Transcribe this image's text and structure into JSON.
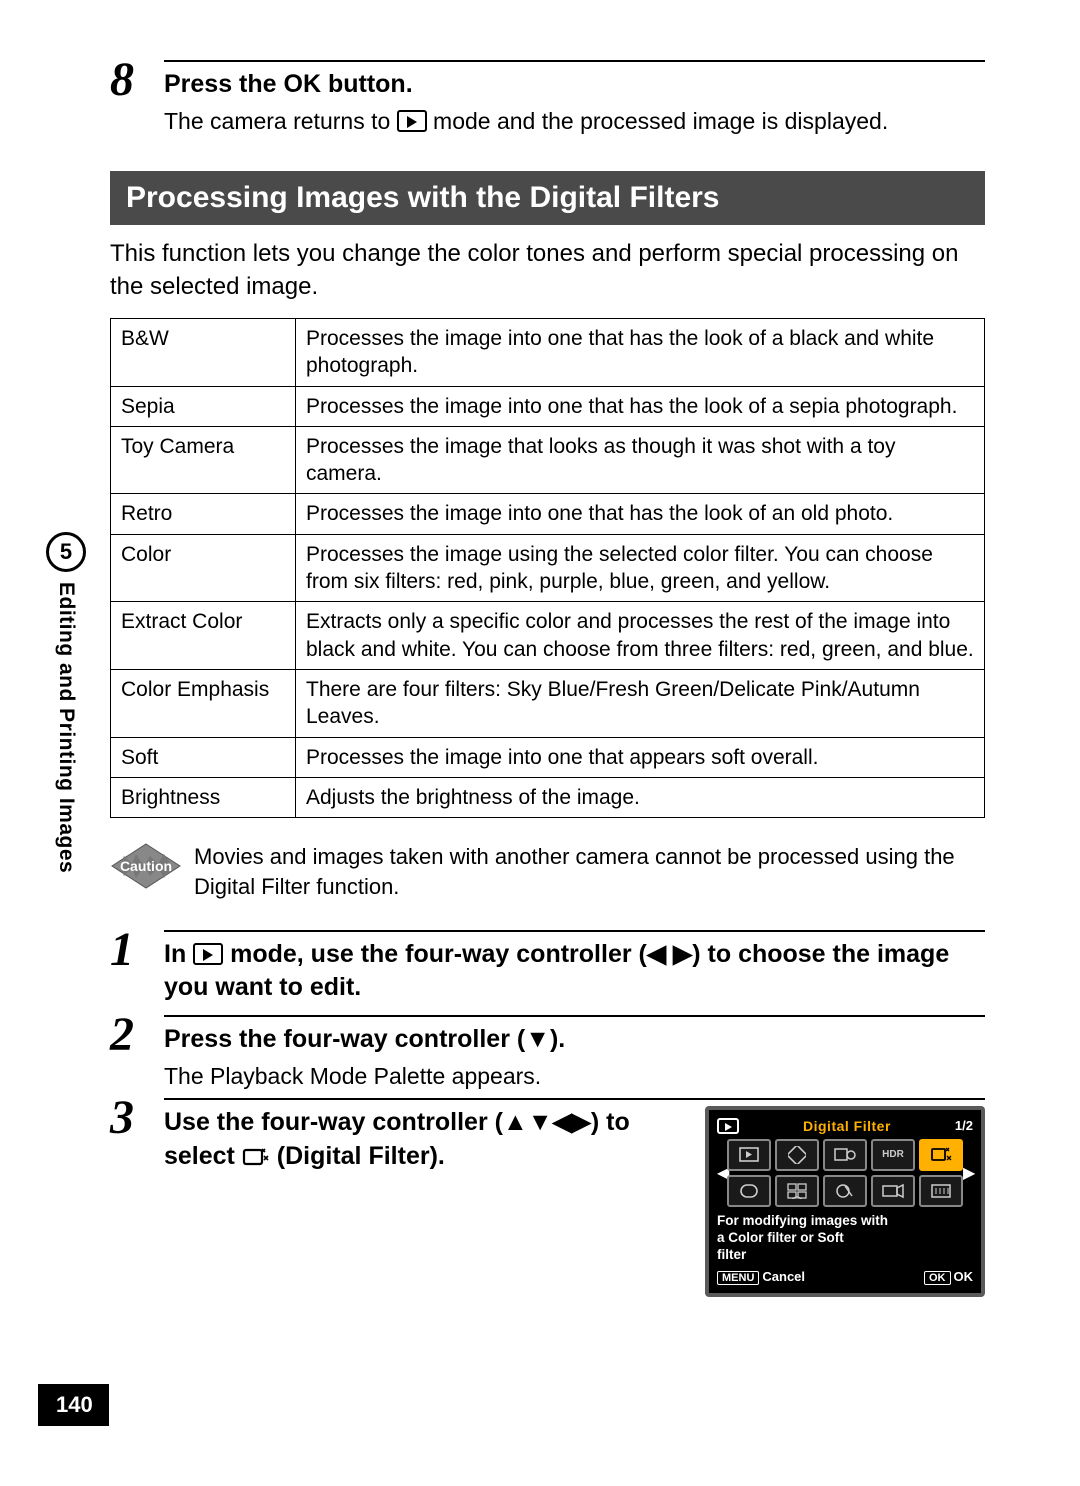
{
  "sidebar": {
    "chapter_num": "5",
    "chapter_label": "Editing and Printing Images"
  },
  "page_number": "140",
  "step8": {
    "num": "8",
    "title_pre": "Press the ",
    "title_btn": "OK",
    "title_post": " button.",
    "desc_pre": "The camera returns to ",
    "desc_post": " mode and the processed image is displayed."
  },
  "section_heading": "Processing Images with the Digital Filters",
  "intro": "This function lets you change the color tones and perform special processing on the selected image.",
  "filters": [
    {
      "name": "B&W",
      "desc": "Processes the image into one that has the look of a black and white photograph."
    },
    {
      "name": "Sepia",
      "desc": "Processes the image into one that has the look of a sepia photograph."
    },
    {
      "name": "Toy Camera",
      "desc": "Processes the image that looks as though it was shot with a toy camera."
    },
    {
      "name": "Retro",
      "desc": "Processes the image into one that has the look of an old photo."
    },
    {
      "name": "Color",
      "desc": "Processes the image using the selected color filter. You can choose from six filters: red, pink, purple, blue, green, and yellow."
    },
    {
      "name": "Extract Color",
      "desc": "Extracts only a specific color and processes the rest of the image into black and white. You can choose from three filters: red, green, and blue."
    },
    {
      "name": "Color Emphasis",
      "desc": "There are four filters: Sky Blue/Fresh Green/Delicate Pink/Autumn Leaves."
    },
    {
      "name": "Soft",
      "desc": "Processes the image into one that appears soft overall."
    },
    {
      "name": "Brightness",
      "desc": "Adjusts the brightness of the image."
    }
  ],
  "caution_label": "Caution",
  "caution_text": "Movies and images taken with another camera cannot be processed using the Digital Filter function.",
  "step1": {
    "num": "1",
    "title_pre": "In ",
    "title_mid": " mode, use the four-way controller (",
    "arrows_lr": "◀ ▶",
    "title_post": ") to choose the image you want to edit."
  },
  "step2": {
    "num": "2",
    "title_pre": "Press the four-way controller (",
    "arrow_down": "▼",
    "title_post": ").",
    "desc": "The Playback Mode Palette appears."
  },
  "step3": {
    "num": "3",
    "title_pre": "Use the four-way controller (",
    "arrows_all": "▲▼◀▶",
    "title_mid": ") to select ",
    "title_post": " (Digital Filter)."
  },
  "lcd": {
    "title": "Digital Filter",
    "page": "1/2",
    "hdr_label": "HDR",
    "msg_l1": "For modifying images with",
    "msg_l2": "a Color filter or Soft",
    "msg_l3": "filter",
    "menu_btn": "MENU",
    "cancel": "Cancel",
    "ok_btn": "OK",
    "ok_label": "OK"
  }
}
